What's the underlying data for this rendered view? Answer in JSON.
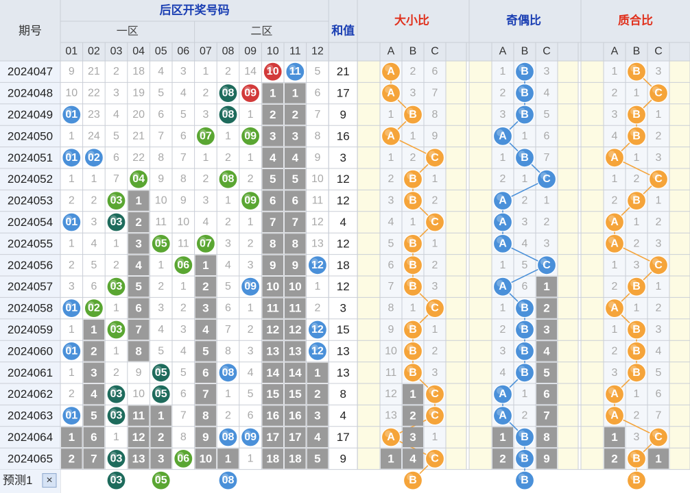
{
  "chart_data": {
    "type": "table",
    "headers": {
      "period": "期号",
      "back_zone": "后区开奖号码",
      "zone1": "一区",
      "zone2": "二区",
      "sum": "和值",
      "size_ratio": "大小比",
      "parity_ratio": "奇偶比",
      "prime_ratio": "质合比",
      "numbers": [
        "01",
        "02",
        "03",
        "04",
        "05",
        "06",
        "07",
        "08",
        "09",
        "10",
        "11",
        "12"
      ],
      "abc": [
        "A",
        "B",
        "C"
      ]
    },
    "rows": [
      {
        "period": "2024047",
        "cells": [
          9,
          21,
          2,
          18,
          4,
          3,
          1,
          2,
          14,
          "10",
          "11",
          5
        ],
        "sum": 21,
        "size": [
          "A",
          2,
          6
        ],
        "parity": [
          1,
          "B",
          3
        ],
        "prime": [
          1,
          "B",
          3
        ]
      },
      {
        "period": "2024048",
        "cells": [
          10,
          22,
          3,
          19,
          5,
          4,
          2,
          "08",
          "09",
          1,
          1,
          6
        ],
        "sum": 17,
        "size": [
          "A",
          3,
          7
        ],
        "parity": [
          2,
          "B",
          4
        ],
        "prime": [
          2,
          1,
          "C"
        ]
      },
      {
        "period": "2024049",
        "cells": [
          "01",
          23,
          4,
          20,
          6,
          5,
          3,
          "08",
          1,
          2,
          2,
          7
        ],
        "sum": 9,
        "size": [
          1,
          "B",
          8
        ],
        "parity": [
          3,
          "B",
          5
        ],
        "prime": [
          3,
          "B",
          1
        ]
      },
      {
        "period": "2024050",
        "cells": [
          1,
          24,
          5,
          21,
          7,
          6,
          "07",
          1,
          "09",
          3,
          3,
          8
        ],
        "sum": 16,
        "size": [
          "A",
          1,
          9
        ],
        "parity": [
          "A",
          1,
          6
        ],
        "prime": [
          4,
          "B",
          2
        ]
      },
      {
        "period": "2024051",
        "cells": [
          "01",
          "02",
          6,
          22,
          8,
          7,
          1,
          2,
          1,
          4,
          4,
          9
        ],
        "sum": 3,
        "size": [
          1,
          2,
          "C"
        ],
        "parity": [
          1,
          "B",
          7
        ],
        "prime": [
          "A",
          1,
          3
        ]
      },
      {
        "period": "2024052",
        "cells": [
          1,
          1,
          7,
          "04",
          9,
          8,
          2,
          "08",
          2,
          5,
          5,
          10
        ],
        "sum": 12,
        "size": [
          2,
          "B",
          1
        ],
        "parity": [
          2,
          1,
          "C"
        ],
        "prime": [
          1,
          2,
          "C"
        ]
      },
      {
        "period": "2024053",
        "cells": [
          2,
          2,
          "03",
          1,
          10,
          9,
          3,
          1,
          "09",
          6,
          6,
          11
        ],
        "sum": 12,
        "size": [
          3,
          "B",
          2
        ],
        "parity": [
          "A",
          2,
          1
        ],
        "prime": [
          2,
          "B",
          1
        ]
      },
      {
        "period": "2024054",
        "cells": [
          "01",
          3,
          "03",
          2,
          11,
          10,
          4,
          2,
          1,
          7,
          7,
          12
        ],
        "sum": 4,
        "size": [
          4,
          1,
          "C"
        ],
        "parity": [
          "A",
          3,
          2
        ],
        "prime": [
          "A",
          1,
          2
        ]
      },
      {
        "period": "2024055",
        "cells": [
          1,
          4,
          1,
          3,
          "05",
          11,
          "07",
          3,
          2,
          8,
          8,
          13
        ],
        "sum": 12,
        "size": [
          5,
          "B",
          1
        ],
        "parity": [
          "A",
          4,
          3
        ],
        "prime": [
          "A",
          2,
          3
        ]
      },
      {
        "period": "2024056",
        "cells": [
          2,
          5,
          2,
          4,
          1,
          "06",
          1,
          4,
          3,
          9,
          9,
          "12"
        ],
        "sum": 18,
        "size": [
          6,
          "B",
          2
        ],
        "parity": [
          1,
          5,
          "C"
        ],
        "prime": [
          1,
          3,
          "C"
        ]
      },
      {
        "period": "2024057",
        "cells": [
          3,
          6,
          "03",
          5,
          2,
          1,
          2,
          5,
          "09",
          10,
          10,
          1
        ],
        "sum": 12,
        "size": [
          7,
          "B",
          3
        ],
        "parity": [
          "A",
          6,
          1
        ],
        "prime": [
          2,
          "B",
          1
        ]
      },
      {
        "period": "2024058",
        "cells": [
          "01",
          "02",
          1,
          6,
          3,
          2,
          3,
          6,
          1,
          11,
          11,
          2
        ],
        "sum": 3,
        "size": [
          8,
          1,
          "C"
        ],
        "parity": [
          1,
          "B",
          2
        ],
        "prime": [
          "A",
          1,
          2
        ]
      },
      {
        "period": "2024059",
        "cells": [
          1,
          1,
          "03",
          7,
          4,
          3,
          4,
          7,
          2,
          12,
          12,
          "12"
        ],
        "sum": 15,
        "size": [
          9,
          "B",
          1
        ],
        "parity": [
          2,
          "B",
          3
        ],
        "prime": [
          1,
          "B",
          3
        ]
      },
      {
        "period": "2024060",
        "cells": [
          "01",
          2,
          1,
          8,
          5,
          4,
          5,
          8,
          3,
          13,
          13,
          "12"
        ],
        "sum": 13,
        "size": [
          10,
          "B",
          2
        ],
        "parity": [
          3,
          "B",
          4
        ],
        "prime": [
          2,
          "B",
          4
        ]
      },
      {
        "period": "2024061",
        "cells": [
          1,
          3,
          2,
          9,
          "05",
          5,
          6,
          "08",
          4,
          14,
          14,
          1
        ],
        "sum": 13,
        "size": [
          11,
          "B",
          3
        ],
        "parity": [
          4,
          "B",
          5
        ],
        "prime": [
          3,
          "B",
          5
        ]
      },
      {
        "period": "2024062",
        "cells": [
          2,
          4,
          "03",
          10,
          "05",
          6,
          7,
          1,
          5,
          15,
          15,
          2
        ],
        "sum": 8,
        "size": [
          12,
          1,
          "C"
        ],
        "parity": [
          "A",
          1,
          6
        ],
        "prime": [
          "A",
          1,
          6
        ]
      },
      {
        "period": "2024063",
        "cells": [
          "01",
          5,
          "03",
          11,
          1,
          7,
          8,
          2,
          6,
          16,
          16,
          3
        ],
        "sum": 4,
        "size": [
          13,
          2,
          "C"
        ],
        "parity": [
          "A",
          2,
          7
        ],
        "prime": [
          "A",
          2,
          7
        ]
      },
      {
        "period": "2024064",
        "cells": [
          1,
          6,
          1,
          12,
          2,
          8,
          9,
          "08",
          "09",
          17,
          17,
          4
        ],
        "sum": 17,
        "size": [
          "A",
          3,
          1
        ],
        "parity": [
          1,
          "B",
          8
        ],
        "prime": [
          1,
          3,
          "C"
        ]
      },
      {
        "period": "2024065",
        "cells": [
          2,
          7,
          "03",
          13,
          3,
          "06",
          10,
          1,
          1,
          18,
          18,
          5
        ],
        "sum": 9,
        "size": [
          1,
          4,
          "C"
        ],
        "parity": [
          2,
          "B",
          9
        ],
        "prime": [
          2,
          "B",
          1
        ]
      }
    ],
    "predict": {
      "label": "预测1",
      "close": "×",
      "balls": [
        "03",
        "05",
        "08"
      ],
      "size": "B",
      "parity": "B",
      "prime": "B"
    },
    "colors": {
      "header_bg": "#e3e8ef",
      "header_title": "#1b3fb3",
      "ratio_title": "#e0301c",
      "parity_title": "#1b3fb3",
      "grid": "#c9ced6",
      "miss_text": "#a9a9a9",
      "gray_cell": "#9a9a9a",
      "orange": "#f5a43a",
      "ball_blue": "#4a90d9",
      "ball_green": "#5aa632",
      "ball_dark_teal": "#1e6b5c",
      "ball_red": "#d23a3a"
    }
  }
}
